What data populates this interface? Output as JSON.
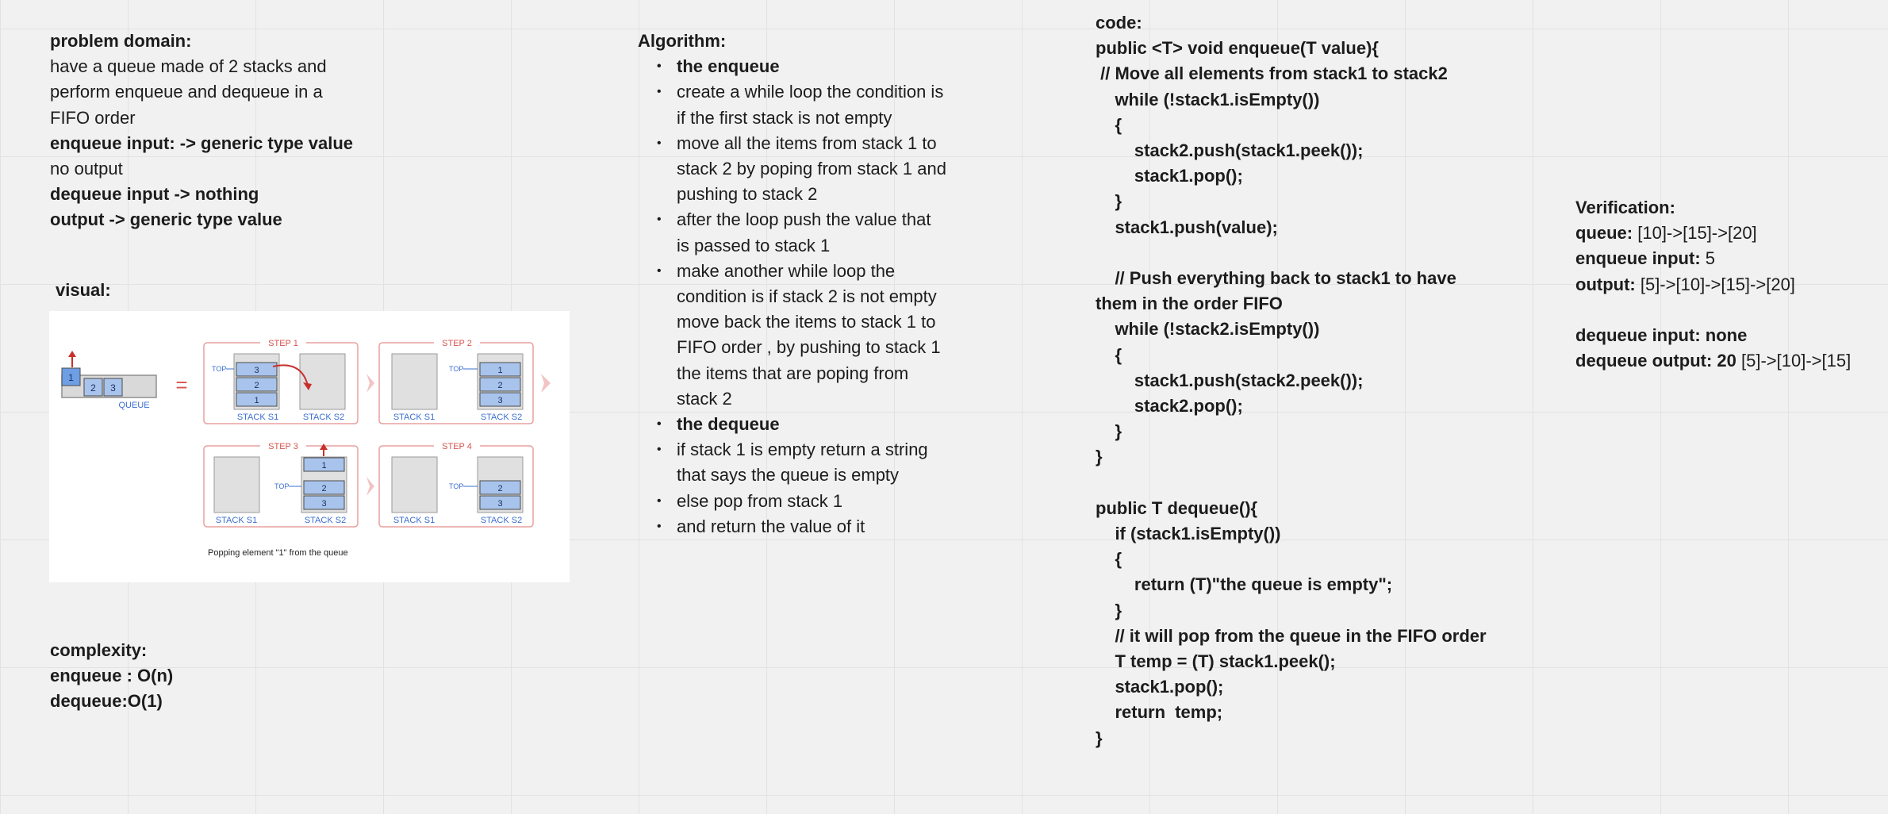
{
  "problem": {
    "heading": "problem domain:",
    "desc1": "have a queue made of 2 stacks and",
    "desc2": "perform enqueue and dequeue in a",
    "desc3": "FIFO order",
    "enq_input": "enqueue input: -> generic type value",
    "no_output": "no output",
    "deq_input": "dequeue input -> nothing",
    "output": "output -> generic type value"
  },
  "visual": {
    "heading": "visual:",
    "main_items": [
      "1",
      "2",
      "3"
    ],
    "queue_label": "QUEUE",
    "equals": "=",
    "top_label": "TOP",
    "stack1_label": "STACK S1",
    "stack2_label": "STACK S2",
    "steps": [
      "STEP 1",
      "STEP 2",
      "STEP 3",
      "STEP 4"
    ],
    "step1_s1": [
      "3",
      "2",
      "1"
    ],
    "step2_s2": [
      "1",
      "2",
      "3"
    ],
    "step3_s2": [
      "1",
      "2",
      "3"
    ],
    "step4_s2": [
      "2",
      "3"
    ],
    "caption": "Popping element \"1\" from the queue",
    "colors": {
      "step_border": "#e8a0a0",
      "step_text": "#d9534f",
      "box_fill": "#a9c4ec",
      "stack_label": "#3b6fd1",
      "arrow_red": "#c9302c"
    }
  },
  "complexity": {
    "heading": "complexity:",
    "enqueue": "enqueue : O(n)",
    "dequeue": "dequeue:O(1)"
  },
  "algorithm": {
    "heading": "Algorithm:",
    "items": [
      {
        "bold": true,
        "lines": [
          "the enqueue"
        ]
      },
      {
        "bold": false,
        "lines": [
          "create a while loop the condition is",
          "if the first stack is not empty"
        ]
      },
      {
        "bold": false,
        "lines": [
          "move all the items from stack 1 to",
          "stack 2 by poping from stack 1 and",
          "pushing to stack 2"
        ]
      },
      {
        "bold": false,
        "lines": [
          "after the loop push the value that",
          "is passed to stack 1"
        ]
      },
      {
        "bold": false,
        "lines": [
          "make another while loop the",
          "condition is if stack 2 is not empty",
          "move back the items to stack 1 to",
          "FIFO order , by pushing to stack 1",
          "the items that are poping from",
          "stack 2"
        ]
      },
      {
        "bold": true,
        "lines": [
          "the dequeue"
        ]
      },
      {
        "bold": false,
        "lines": [
          "if stack 1 is empty return a string",
          "that says the queue is empty"
        ]
      },
      {
        "bold": false,
        "lines": [
          "else pop from stack 1"
        ]
      },
      {
        "bold": false,
        "lines": [
          "and return the value of it"
        ]
      }
    ]
  },
  "code": {
    "heading": "code:",
    "lines": [
      "public <T> void enqueue(T value){",
      " // Move all elements from stack1 to stack2",
      "    while (!stack1.isEmpty())",
      "    {",
      "        stack2.push(stack1.peek());",
      "        stack1.pop();",
      "    }",
      "    stack1.push(value);",
      "",
      "    // Push everything back to stack1 to have",
      "them in the order FIFO",
      "    while (!stack2.isEmpty())",
      "    {",
      "        stack1.push(stack2.peek());",
      "        stack2.pop();",
      "    }",
      "}",
      "",
      "public T dequeue(){",
      "    if (stack1.isEmpty())",
      "    {",
      "        return (T)\"the queue is empty\";",
      "    }",
      "    // it will pop from the queue in the FIFO order",
      "    T temp = (T) stack1.peek();",
      "    stack1.pop();",
      "    return  temp;",
      "}"
    ]
  },
  "verification": {
    "heading": "Verification:",
    "queue_label": "queue:",
    "queue_value": " [10]->[15]->[20]",
    "enq_label": "enqueue input:",
    "enq_value": " 5",
    "output_label": "output:",
    "output_value": " [5]->[10]->[15]->[20]",
    "deq_input": "dequeue input: none",
    "deq_output_label": "dequeue output: 20",
    "deq_output_value": " [5]->[10]->[15]"
  }
}
